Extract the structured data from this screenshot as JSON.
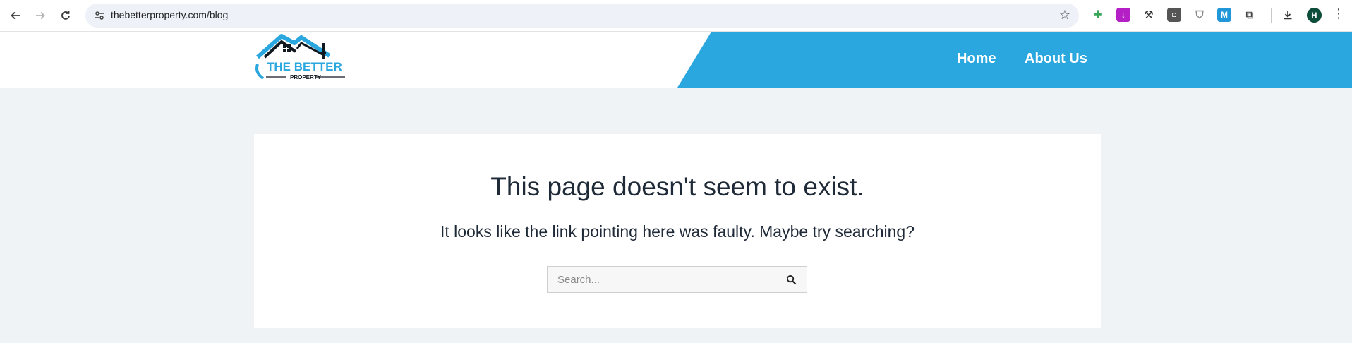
{
  "browser": {
    "url": "thebetterproperty.com/blog",
    "avatar_initial": "H"
  },
  "header": {
    "logo": {
      "line1": "THE BETTER",
      "line2": "PROPERTY"
    },
    "nav": [
      {
        "label": "Home"
      },
      {
        "label": "About Us"
      }
    ],
    "accent_color": "#2aa7df"
  },
  "main": {
    "title": "This page doesn't seem to exist.",
    "subtitle": "It looks like the link pointing here was faulty. Maybe try searching?",
    "search": {
      "placeholder": "Search..."
    }
  }
}
